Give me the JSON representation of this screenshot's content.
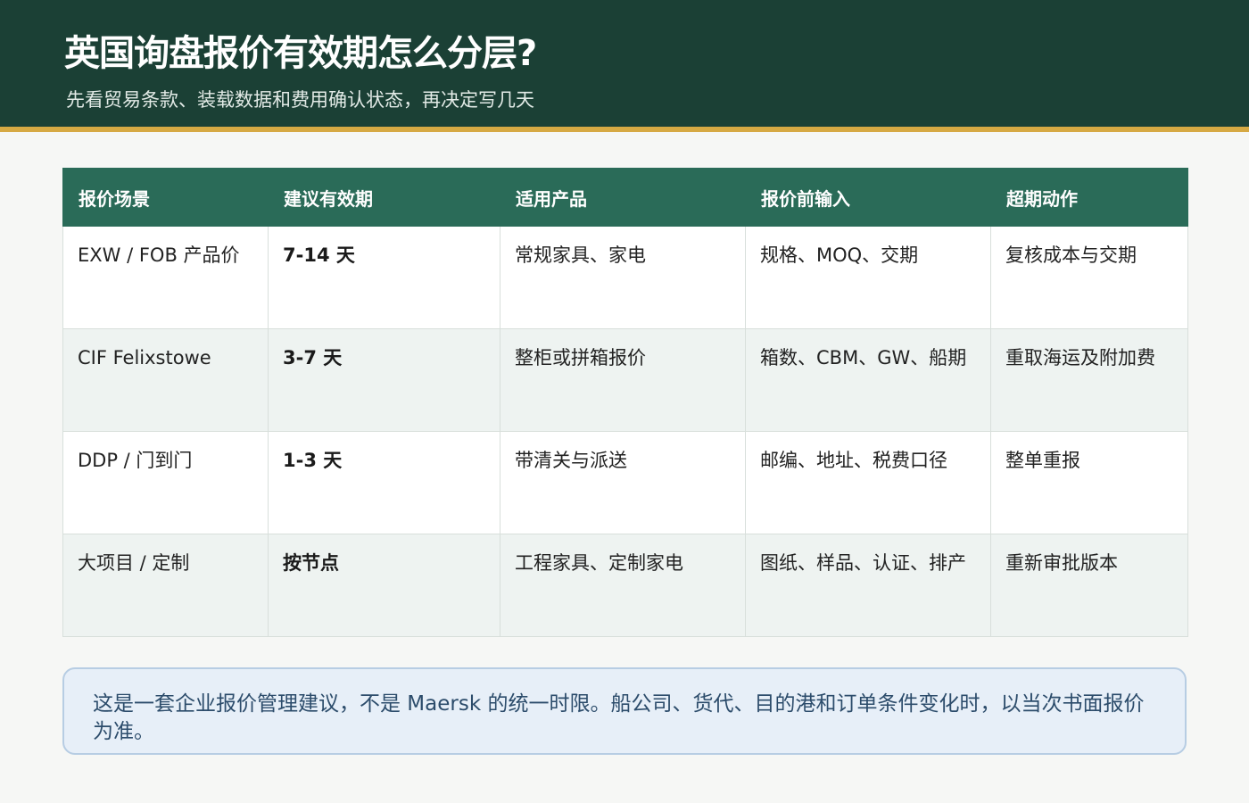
{
  "header": {
    "title": "英国询盘报价有效期怎么分层?",
    "subtitle": "先看贸易条款、装载数据和费用确认状态，再决定写几天"
  },
  "colors": {
    "header_bg": "#1b4035",
    "header_accent": "#d6a943",
    "table_header_bg": "#2a6b58",
    "note_bg": "#e7eff8",
    "note_text": "#2c4c6b"
  },
  "table": {
    "columns": [
      "报价场景",
      "建议有效期",
      "适用产品",
      "报价前输入",
      "超期动作"
    ],
    "rows": [
      [
        "EXW / FOB 产品价",
        "7-14 天",
        "常规家具、家电",
        "规格、MOQ、交期",
        "复核成本与交期"
      ],
      [
        "CIF Felixstowe",
        "3-7 天",
        "整柜或拼箱报价",
        "箱数、CBM、GW、船期",
        "重取海运及附加费"
      ],
      [
        "DDP / 门到门",
        "1-3 天",
        "带清关与派送",
        "邮编、地址、税费口径",
        "整单重报"
      ],
      [
        "大项目 / 定制",
        "按节点",
        "工程家具、定制家电",
        "图纸、样品、认证、排产",
        "重新审批版本"
      ]
    ]
  },
  "note": {
    "text": "这是一套企业报价管理建议，不是 Maersk 的统一时限。船公司、货代、目的港和订单条件变化时，以当次书面报价为准。"
  }
}
